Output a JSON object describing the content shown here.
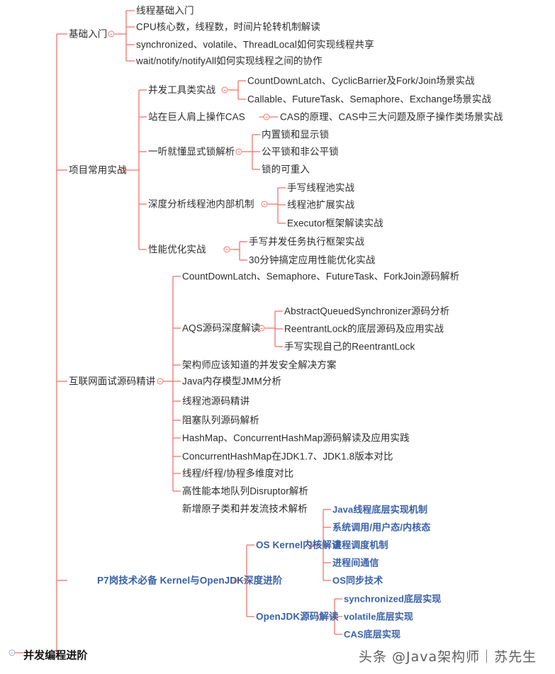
{
  "meta": {
    "root_label": "并发编程进阶",
    "watermark": "头条 @Java架构师｜苏先生",
    "accent_red": "#f4736b",
    "accent_blue": "#3a62a8",
    "text_color": "#2d2d2d"
  },
  "branches": [
    {
      "label": "基础入门",
      "children": [
        {
          "label": "线程基础入门"
        },
        {
          "label": "CPU核心数，线程数，时间片轮转机制解读"
        },
        {
          "label": "synchronized、volatile、ThreadLocal如何实现线程共享"
        },
        {
          "label": "wait/notify/notifyAll如何实现线程之间的协作"
        }
      ]
    },
    {
      "label": "项目常用实战",
      "children": [
        {
          "label": "并发工具类实战",
          "children": [
            {
              "label": "CountDownLatch、CyclicBarrier及Fork/Join场景实战"
            },
            {
              "label": "Callable、FutureTask、Semaphore、Exchange场景实战"
            }
          ]
        },
        {
          "label": "站在巨人肩上操作CAS",
          "children": [
            {
              "label": "CAS的原理、CAS中三大问题及原子操作类场景实战"
            }
          ]
        },
        {
          "label": "一听就懂显式锁解析",
          "children": [
            {
              "label": "内置锁和显示锁"
            },
            {
              "label": "公平锁和非公平锁"
            },
            {
              "label": "锁的可重入"
            }
          ]
        },
        {
          "label": "深度分析线程池内部机制",
          "children": [
            {
              "label": "手写线程池实战"
            },
            {
              "label": "线程池扩展实战"
            },
            {
              "label": "Executor框架解读实战"
            }
          ]
        },
        {
          "label": "性能优化实战",
          "children": [
            {
              "label": "手写并发任务执行框架实战"
            },
            {
              "label": "30分钟搞定应用性能优化实战"
            }
          ]
        }
      ]
    },
    {
      "label": "互联网面试源码精讲",
      "children": [
        {
          "label": "CountDownLatch、Semaphore、FutureTask、ForkJoin源码解析"
        },
        {
          "label": "AQS源码深度解读",
          "children": [
            {
              "label": "AbstractQueuedSynchronizer源码分析"
            },
            {
              "label": "ReentrantLock的底层源码及应用实战"
            },
            {
              "label": "手写实现自己的ReentrantLock"
            }
          ]
        },
        {
          "label": "架构师应该知道的并发安全解决方案"
        },
        {
          "label": "Java内存模型JMM分析"
        },
        {
          "label": "线程池源码精讲"
        },
        {
          "label": "阻塞队列源码解析"
        },
        {
          "label": "HashMap、ConcurrentHashMap源码解读及应用实践"
        },
        {
          "label": "ConcurrentHashMap在JDK1.7、JDK1.8版本对比"
        },
        {
          "label": "线程/纤程/协程多维度对比"
        },
        {
          "label": "高性能本地队列Disruptor解析"
        },
        {
          "label": "新增原子类和并发流技术解析"
        }
      ]
    },
    {
      "label": "P7岗技术必备 Kernel与OpenJDK深度进阶",
      "style": "blue",
      "children": [
        {
          "label": "OS Kernel内核解读",
          "style": "blue",
          "children": [
            {
              "label": "Java线程底层实现机制"
            },
            {
              "label": "系统调用/用户态/内核态"
            },
            {
              "label": "进程调度机制"
            },
            {
              "label": "进程间通信"
            },
            {
              "label": "OS同步技术"
            }
          ]
        },
        {
          "label": "OpenJDK源码解读",
          "style": "blue",
          "children": [
            {
              "label": "synchronized底层实现"
            },
            {
              "label": "volatile底层实现"
            },
            {
              "label": "CAS底层实现"
            }
          ]
        }
      ]
    }
  ]
}
